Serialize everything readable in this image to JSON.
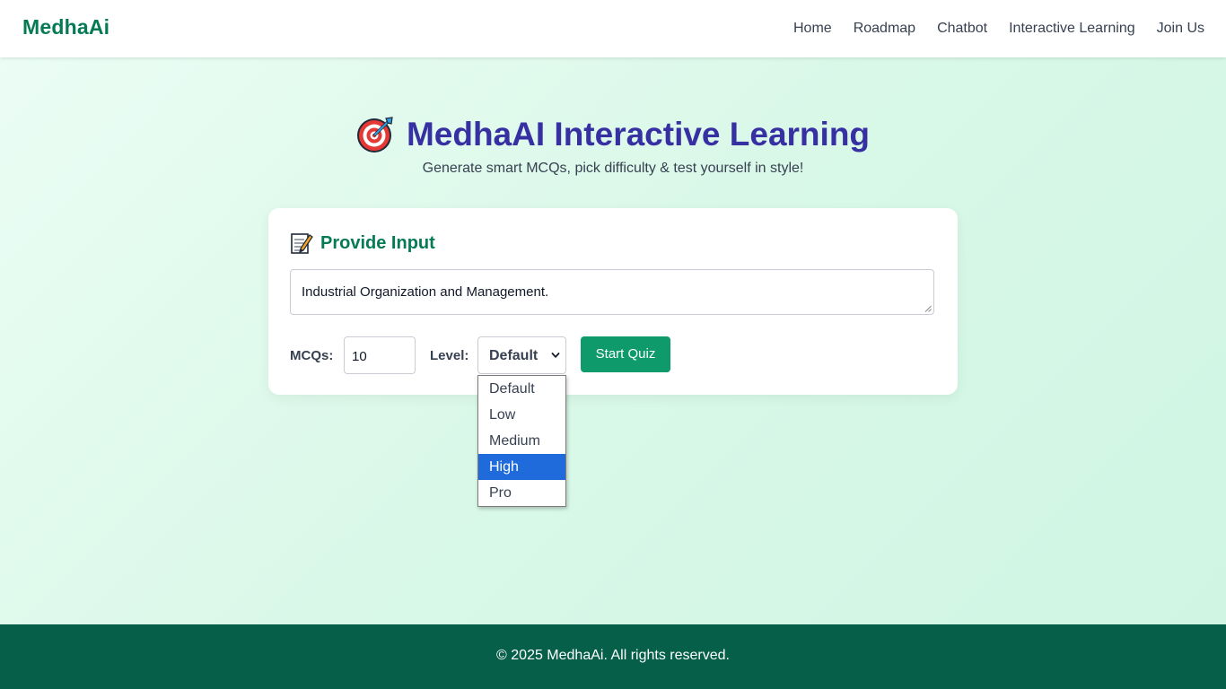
{
  "navbar": {
    "brand": "MedhaAi",
    "links": [
      "Home",
      "Roadmap",
      "Chatbot",
      "Interactive Learning",
      "Join Us"
    ]
  },
  "hero": {
    "icon": "direct-hit-target-icon",
    "title": "MedhaAI Interactive Learning",
    "subtitle": "Generate smart MCQs, pick difficulty & test yourself in style!"
  },
  "card": {
    "icon": "memo-icon",
    "heading": "Provide Input",
    "topic_value": "Industrial Organization and Management.",
    "mcq_label": "MCQs:",
    "mcq_value": "10",
    "level_label": "Level:",
    "level_value": "Default",
    "start_button": "Start Quiz"
  },
  "dropdown": {
    "options": [
      "Default",
      "Low",
      "Medium",
      "High",
      "Pro"
    ],
    "highlighted": "High"
  },
  "footer": {
    "text": "© 2025 MedhaAi. All rights reserved."
  },
  "colors": {
    "brand_green": "#067a55",
    "title_indigo": "#3730a3",
    "button_green": "#0e9a6a",
    "footer_green": "#066049",
    "highlight_blue": "#1f6bdc"
  }
}
